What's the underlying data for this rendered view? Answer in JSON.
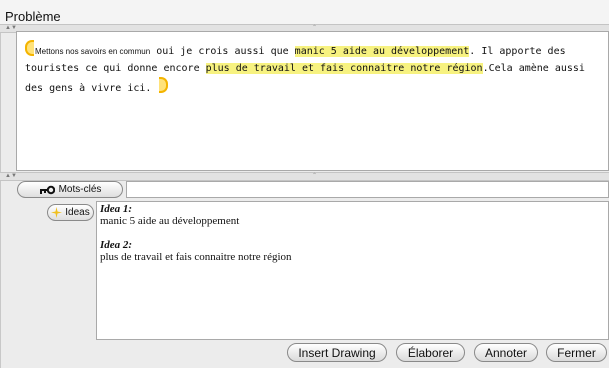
{
  "window": {
    "title": "Problème"
  },
  "text": {
    "lead_small": "Mettons nos savoirs en commun",
    "part1": " oui je crois aussi que ",
    "highlight1": "manic 5 aide au développement",
    "part2": ". Il apporte des touristes ce qui donne encore ",
    "highlight2": "plus de travail et fais connaitre notre région",
    "part3": ".Cela amène aussi des gens à vivre ici. "
  },
  "keywords": {
    "label": "Mots-clés",
    "icon": "key-icon",
    "value": ""
  },
  "ideas": {
    "button_label": "Ideas",
    "icon": "sparkle-icon",
    "items": [
      {
        "title": "Idea 1:",
        "text": "manic 5 aide au développement"
      },
      {
        "title": "Idea 2:",
        "text": "plus de travail et fais connaitre notre région"
      }
    ]
  },
  "buttons": {
    "insert_drawing": "Insert Drawing",
    "elaborer": "Élaborer",
    "annoter": "Annoter",
    "fermer": "Fermer"
  },
  "colors": {
    "highlight": "#f7f280",
    "bracket": "#f4b400"
  }
}
